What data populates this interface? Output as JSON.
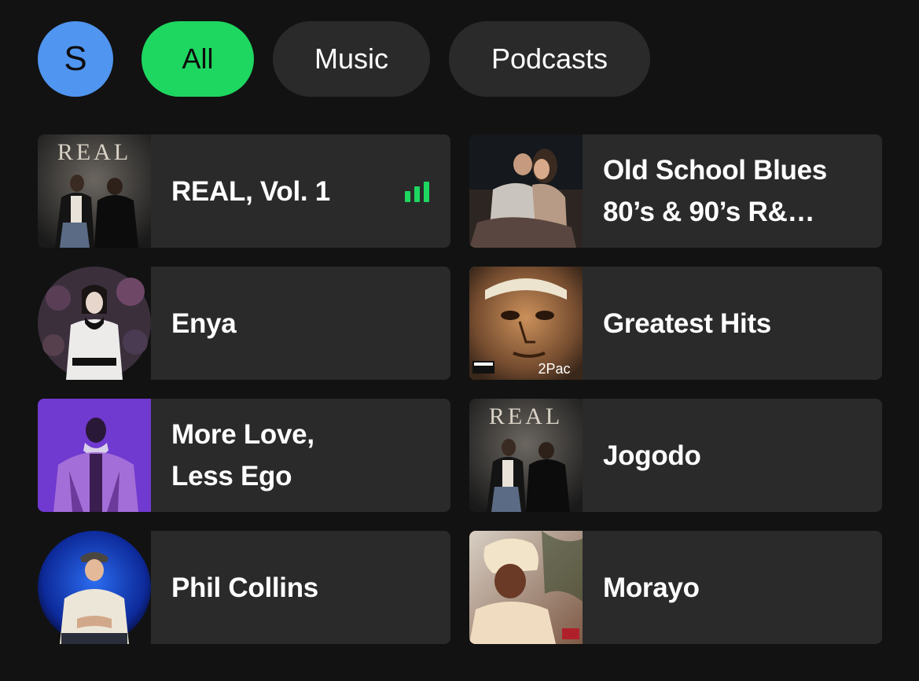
{
  "profile": {
    "initial": "S",
    "color": "#5095f0"
  },
  "filters": [
    {
      "label": "All",
      "selected": true
    },
    {
      "label": "Music",
      "selected": false
    },
    {
      "label": "Podcasts",
      "selected": false
    }
  ],
  "colors": {
    "background": "#121212",
    "card": "#2a2a2a",
    "accent": "#1ed760",
    "chip": "#2a2a2a"
  },
  "shortcuts": [
    {
      "title": "REAL, Vol. 1",
      "art_text": "REAL",
      "now_playing": true,
      "icon": "equalizer-icon"
    },
    {
      "title": "Old School Blues\n80’s & 90’s R&…",
      "now_playing": false
    },
    {
      "title": "Enya",
      "now_playing": false
    },
    {
      "title": "Greatest Hits",
      "art_text": "2Pac",
      "now_playing": false
    },
    {
      "title": "More Love,\nLess Ego",
      "now_playing": false
    },
    {
      "title": "Jogodo",
      "art_text": "REAL",
      "now_playing": false
    },
    {
      "title": "Phil Collins",
      "now_playing": false
    },
    {
      "title": "Morayo",
      "now_playing": false
    }
  ]
}
